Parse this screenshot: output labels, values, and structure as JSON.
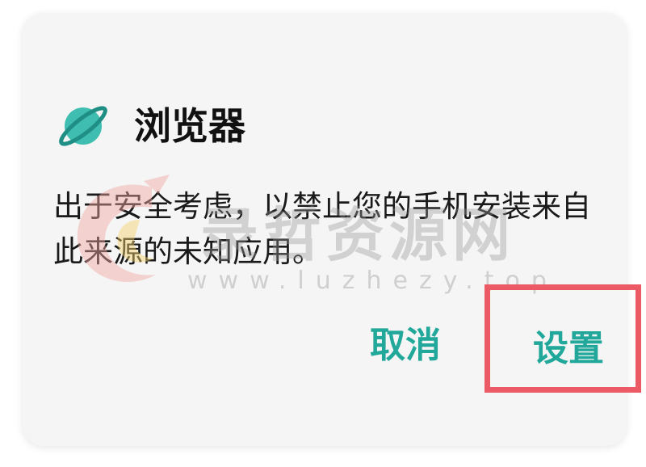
{
  "dialog": {
    "app_name": "浏览器",
    "message": "出于安全考虑，以禁止您的手机安装来自此来源的未知应用。",
    "buttons": {
      "cancel_label": "取消",
      "settings_label": "设置"
    },
    "app_icon": "planet-icon"
  },
  "watermark": {
    "text": "录哲资源网",
    "url": "www.luzhezy.top"
  },
  "colors": {
    "accent": "#21a89a",
    "highlight": "#ec5a66",
    "icon_planet": "#3fbdb0",
    "icon_ring": "#1f8f86"
  }
}
